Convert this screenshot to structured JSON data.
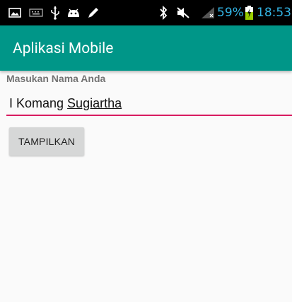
{
  "status_bar": {
    "left_icons": [
      "image-icon",
      "keyboard-icon",
      "usb-icon",
      "android-debug-icon",
      "pencil-icon"
    ],
    "right_icons": [
      "bluetooth-icon",
      "mute-icon",
      "signal-icon",
      "battery-charging-icon"
    ],
    "battery_percent": "59%",
    "time": "18:53",
    "accent_color": "#33b5e5"
  },
  "app_bar": {
    "title": "Aplikasi Mobile",
    "color": "#009688"
  },
  "form": {
    "label": "Masukan Nama Anda",
    "input": {
      "value_plain": "I Komang ",
      "value_underlined": "Sugiartha",
      "underline_color": "#d81b60"
    },
    "button_label": "TAMPILKAN"
  }
}
